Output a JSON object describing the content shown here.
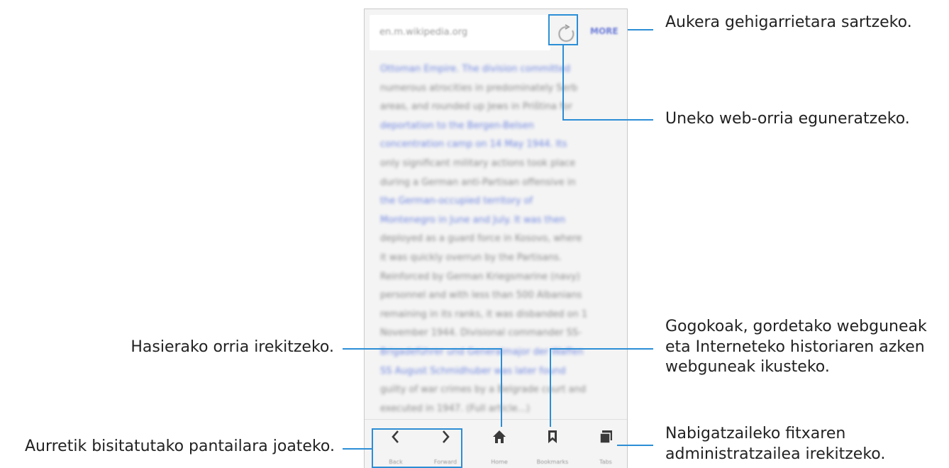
{
  "browser": {
    "url": "en.m.wikipedia.org",
    "more_label": "MORE",
    "content_lines": [
      [
        "Ottoman Empire. The division committed",
        true
      ],
      [
        "numerous atrocities in predominately Serb",
        false
      ],
      [
        "areas, and rounded up Jews in Priština for",
        false
      ],
      [
        "deportation to the Bergen-Belsen",
        true
      ],
      [
        "concentration camp on 14 May 1944. Its",
        true
      ],
      [
        "only significant military actions took place",
        false
      ],
      [
        "during a German anti-Partisan offensive in",
        false
      ],
      [
        "the German-occupied territory of",
        true
      ],
      [
        "Montenegro in June and July. It was then",
        true
      ],
      [
        "deployed as a guard force in Kosovo, where",
        false
      ],
      [
        "it was quickly overrun by the Partisans.",
        false
      ],
      [
        "Reinforced by German Kriegsmarine (navy)",
        false
      ],
      [
        "personnel and with less than 500 Albanians",
        false
      ],
      [
        "remaining in its ranks, it was disbanded on 1",
        false
      ],
      [
        "November 1944. Divisional commander SS-",
        false
      ],
      [
        "Brigadeführer und Generalmajor der Waffen",
        true
      ],
      [
        "SS August Schmidhuber was later found",
        true
      ],
      [
        "guilty of war crimes by a Belgrade court and",
        false
      ],
      [
        "executed in 1947. (Full article...)",
        false
      ]
    ],
    "nav": {
      "back": "Back",
      "forward": "Forward",
      "home": "Home",
      "bookmarks": "Bookmarks",
      "tabs": "Tabs"
    }
  },
  "callouts": {
    "more": "Aukera gehigarrietara sartzeko.",
    "refresh": "Uneko web-orria eguneratzeko.",
    "bookmarks": [
      "Gogokoak, gordetako webguneak",
      "eta Interneteko historiaren azken",
      "webguneak ikusteko."
    ],
    "home": "Hasierako orria irekitzeko.",
    "back_forward": "Aurretik bisitatutako pantailara joateko.",
    "tabs": [
      "Nabigatzaileko fitxaren",
      "administratzailea irekitzeko."
    ]
  },
  "colors": {
    "accent": "#2c8ed6",
    "link": "#6f86e0"
  }
}
